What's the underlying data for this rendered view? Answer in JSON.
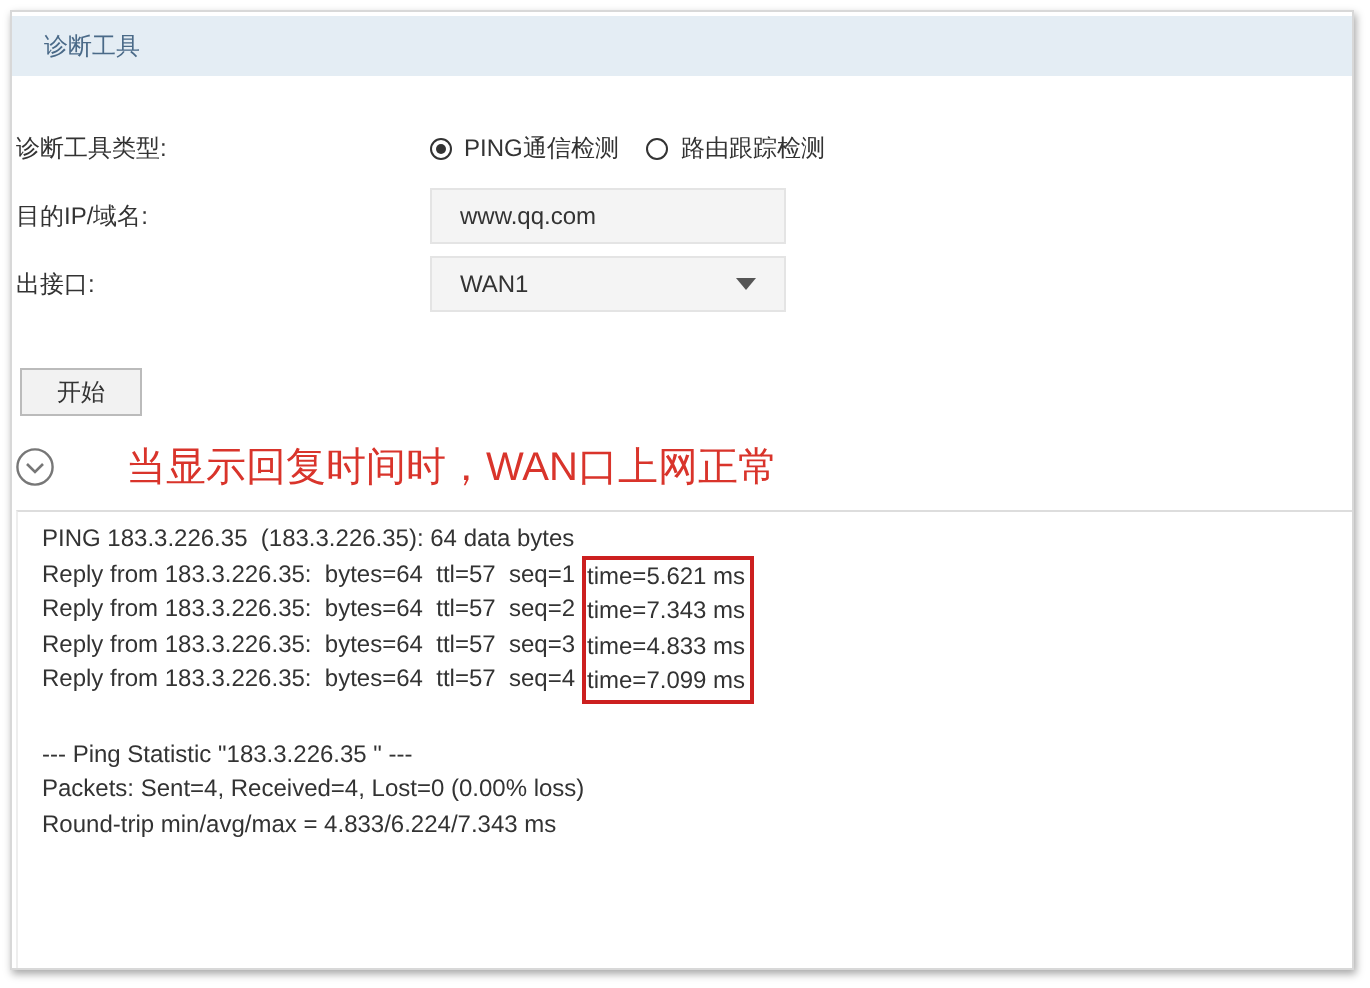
{
  "panel": {
    "title": "诊断工具"
  },
  "form": {
    "tool_type": {
      "label": "诊断工具类型:",
      "options": [
        {
          "label": "PING通信检测",
          "selected": true
        },
        {
          "label": "路由跟踪检测",
          "selected": false
        }
      ]
    },
    "target": {
      "label": "目的IP/域名:",
      "value": "www.qq.com"
    },
    "interface": {
      "label": "出接口:",
      "value": "WAN1"
    },
    "start_button": "开始"
  },
  "annotation": "当显示回复时间时，WAN口上网正常",
  "output": {
    "header": "PING 183.3.226.35  (183.3.226.35): 64 data bytes",
    "replies": [
      {
        "text": "Reply from 183.3.226.35:  bytes=64  ttl=57  seq=1",
        "time": "time=5.621 ms"
      },
      {
        "text": "Reply from 183.3.226.35:  bytes=64  ttl=57  seq=2",
        "time": "time=7.343 ms"
      },
      {
        "text": "Reply from 183.3.226.35:  bytes=64  ttl=57  seq=3",
        "time": "time=4.833 ms"
      },
      {
        "text": "Reply from 183.3.226.35:  bytes=64  ttl=57  seq=4",
        "time": "time=7.099 ms"
      }
    ],
    "statistics": [
      "--- Ping Statistic \"183.3.226.35 \" ---",
      "Packets: Sent=4, Received=4, Lost=0 (0.00% loss)",
      "Round-trip min/avg/max = 4.833/6.224/7.343 ms"
    ]
  }
}
